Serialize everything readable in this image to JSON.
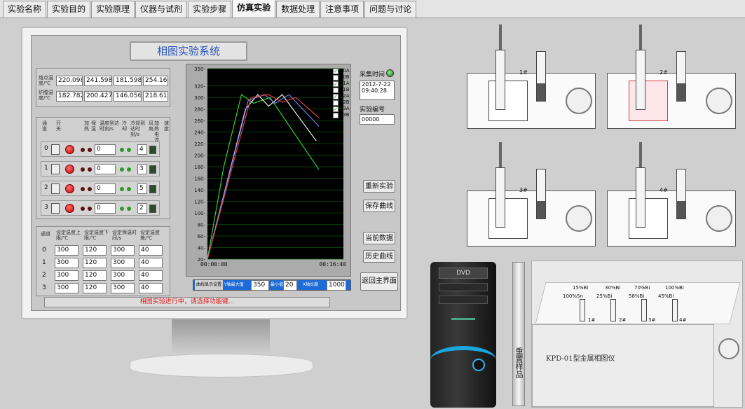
{
  "tabs": [
    {
      "label": "实验名称",
      "active": false
    },
    {
      "label": "实验目的",
      "active": false
    },
    {
      "label": "实验原理",
      "active": false
    },
    {
      "label": "仪器与试剂",
      "active": false
    },
    {
      "label": "实验步骤",
      "active": false
    },
    {
      "label": "仿真实验",
      "active": true
    },
    {
      "label": "数据处理",
      "active": false
    },
    {
      "label": "注意事项",
      "active": false
    },
    {
      "label": "问题与讨论",
      "active": false
    }
  ],
  "system_title": "相图实验系统",
  "temps": {
    "row1_label": "熔点温度/℃",
    "row1": [
      "220.098",
      "241.598",
      "181.598",
      "254.16"
    ],
    "row2_label": "炉膛温度/℃",
    "row2": [
      "182.782",
      "200.427",
      "146.056",
      "218.61"
    ]
  },
  "channels": {
    "headers": [
      "通道",
      "开关",
      "加热",
      "保温",
      "温度到达时刻/s",
      "冷却",
      "冷却到达时刻/s",
      "风扇",
      "加热电流",
      "速度"
    ],
    "rows": [
      {
        "ch": "0",
        "time": "0",
        "speed": "4"
      },
      {
        "ch": "1",
        "time": "0",
        "speed": "3"
      },
      {
        "ch": "2",
        "time": "0",
        "speed": "5"
      },
      {
        "ch": "3",
        "time": "0",
        "speed": "2"
      }
    ]
  },
  "settings": {
    "headers": [
      "通道",
      "设定温度上限/℃",
      "设定温度下限/℃",
      "设定保温时间/s",
      "设定温度差/℃"
    ],
    "rows": [
      {
        "ch": "0",
        "a": "300",
        "b": "120",
        "c": "300",
        "d": "40"
      },
      {
        "ch": "1",
        "a": "300",
        "b": "120",
        "c": "300",
        "d": "40"
      },
      {
        "ch": "2",
        "a": "300",
        "b": "120",
        "c": "300",
        "d": "40"
      },
      {
        "ch": "3",
        "a": "300",
        "b": "120",
        "c": "300",
        "d": "40"
      }
    ]
  },
  "status_text": "相图实验进行中，请选择功能键...",
  "acq": {
    "label": "采集时间",
    "date": "2012-7-22",
    "time": "09:40:28",
    "exp_label": "实验编号",
    "exp_no": "00000"
  },
  "buttons": {
    "restart": "重新实验",
    "save": "保存曲线",
    "current": "当前数据",
    "history": "历史曲线",
    "back": "返回主界面",
    "reset_sample": "重置样品"
  },
  "legend": [
    {
      "name": "T0A",
      "checked": true
    },
    {
      "name": "T0B",
      "checked": false
    },
    {
      "name": "T1A",
      "checked": true
    },
    {
      "name": "T1B",
      "checked": false
    },
    {
      "name": "T2A",
      "checked": true
    },
    {
      "name": "T2B",
      "checked": false
    },
    {
      "name": "T3A",
      "checked": true
    },
    {
      "name": "T3B",
      "checked": false
    }
  ],
  "chart_bottom": {
    "label": "曲线显示设置",
    "ymax_label": "Y轴最大值",
    "ymax": "350",
    "ymin_label": "最小值",
    "ymin": "20",
    "x_label": "X轴长度",
    "xlen": "1000"
  },
  "chart_data": {
    "type": "line",
    "xlabel": "",
    "ylabel": "",
    "x_ticks": [
      "00:00:00",
      "00:16:40"
    ],
    "ylim": [
      20,
      350
    ],
    "y_ticks": [
      20,
      40,
      60,
      80,
      100,
      120,
      140,
      160,
      180,
      200,
      220,
      240,
      260,
      280,
      300,
      320,
      350
    ],
    "grid": true,
    "series": [
      {
        "color": "#33dd33",
        "x": [
          0,
          0.12,
          0.25,
          0.34,
          0.46,
          0.82
        ],
        "y": [
          20,
          180,
          305,
          290,
          300,
          175
        ]
      },
      {
        "color": "#ffffff",
        "x": [
          0,
          0.28,
          0.37,
          0.45,
          0.55,
          0.8
        ],
        "y": [
          20,
          280,
          305,
          285,
          305,
          225
        ]
      },
      {
        "color": "#7f7fff",
        "x": [
          0,
          0.3,
          0.42,
          0.5,
          0.6,
          0.82
        ],
        "y": [
          20,
          295,
          305,
          290,
          305,
          250
        ]
      },
      {
        "color": "#ee4444",
        "x": [
          0,
          0.32,
          0.45,
          0.55,
          0.65,
          0.82
        ],
        "y": [
          20,
          300,
          305,
          292,
          300,
          265
        ]
      }
    ]
  },
  "cells": [
    {
      "label": "1#"
    },
    {
      "label": "2#"
    },
    {
      "label": "3#"
    },
    {
      "label": "4#"
    }
  ],
  "tower_label": "DVD",
  "device": {
    "name": "KPD-01型金属相图仪",
    "sample_labels": [
      "15%Bi",
      "100%Sn",
      "30%Bi",
      "25%Bi",
      "70%Bi",
      "58%Bi",
      "100%Bi",
      "45%Bi"
    ],
    "slot_labels": [
      "1#",
      "2#",
      "3#",
      "4#"
    ]
  }
}
